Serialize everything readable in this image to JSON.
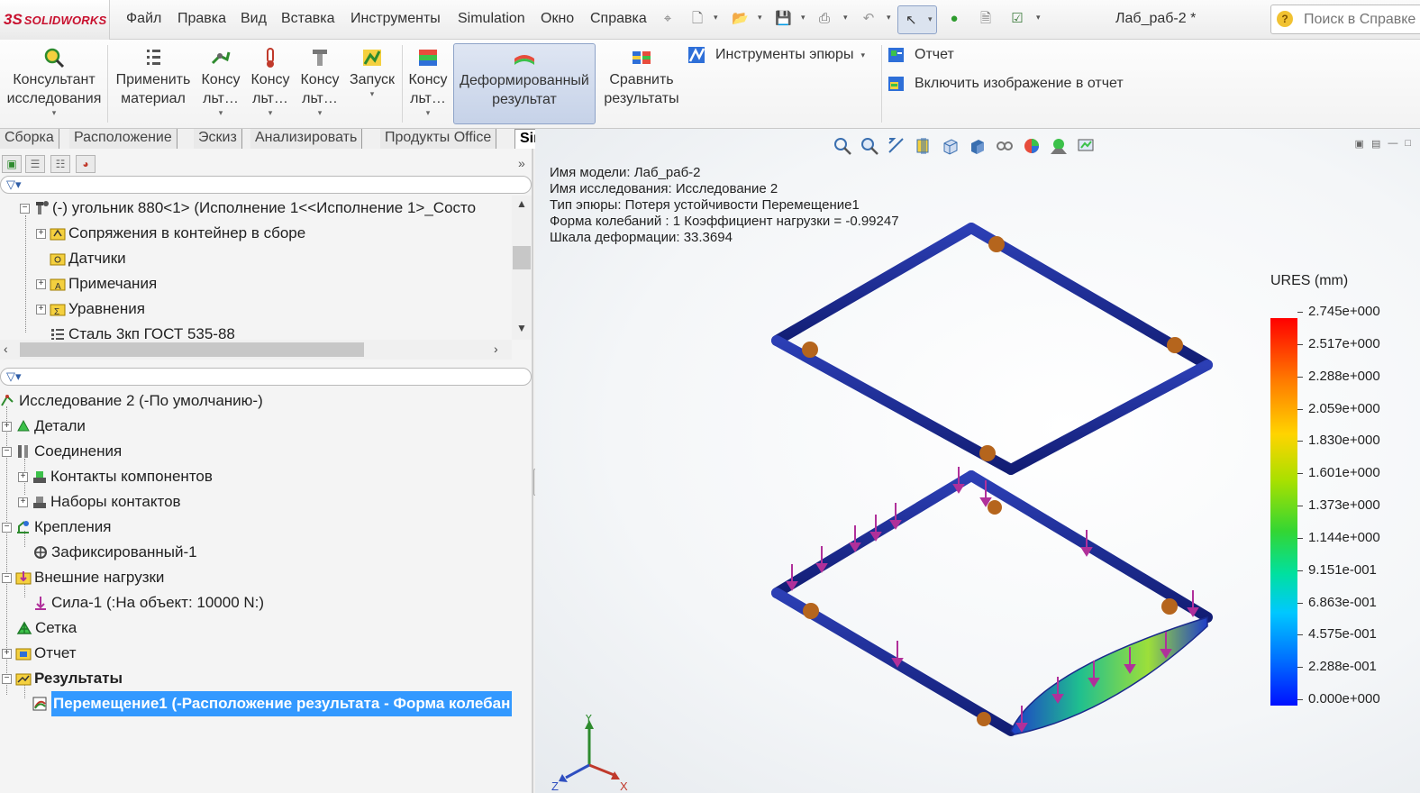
{
  "app": {
    "logo_ds": "3S",
    "logo_name": "SOLIDWORKS"
  },
  "menu": [
    "Файл",
    "Правка",
    "Вид",
    "Вставка",
    "Инструменты",
    "Simulation",
    "Окно",
    "Справка"
  ],
  "document_title": "Лаб_раб-2 *",
  "search": {
    "placeholder": "Поиск в Справке"
  },
  "ribbon": {
    "consultant": "Консультант исследования",
    "apply_material": "Применить материал",
    "konsult1": "Консу льт…",
    "konsult2": "Консу льт…",
    "konsult3": "Консу льт…",
    "run": "Запуск",
    "konsult4": "Консу льт…",
    "deformed": "Деформированный результат",
    "compare": "Сравнить результаты",
    "plot_tools": "Инструменты эпюры",
    "report": "Отчет",
    "include_image": "Включить изображение в отчет"
  },
  "tabs": [
    "Сборка",
    "Расположение",
    "Эскиз",
    "Анализировать",
    "Продукты Office",
    "Simulation"
  ],
  "active_tab": "Simulation",
  "feature_tree": {
    "root": "(-) угольник 880<1> (Исполнение 1<<Исполнение 1>_Состо",
    "items": [
      "Сопряжения в контейнер в сборе",
      "Датчики",
      "Примечания",
      "Уравнения",
      "Сталь 3кп ГОСТ 535-88"
    ]
  },
  "study_tree": {
    "study": "Исследование 2 (-По умолчанию-)",
    "parts": "Детали",
    "connections": "Соединения",
    "component_contacts": "Контакты компонентов",
    "contact_sets": "Наборы контактов",
    "fixtures": "Крепления",
    "fixed": "Зафиксированный-1",
    "external_loads": "Внешние нагрузки",
    "force": "Сила-1 (:На объект: 10000 N:)",
    "mesh": "Сетка",
    "report": "Отчет",
    "results": "Результаты",
    "displacement": "Перемещение1 (-Расположение результата - Форма колебан"
  },
  "plot_info": {
    "model_name": "Имя модели: Лаб_раб-2",
    "study_name": "Имя  исследования: Исследование 2",
    "plot_type": "Тип эпюры: Потеря устойчивости Перемещение1",
    "mode_shape": "Форма колебаний : 1  Коэффициент нагрузки = -0.99247",
    "deformation_scale": "Шкала деформации: 33.3694"
  },
  "legend": {
    "title": "URES (mm)",
    "values": [
      "2.745e+000",
      "2.517e+000",
      "2.288e+000",
      "2.059e+000",
      "1.830e+000",
      "1.601e+000",
      "1.373e+000",
      "1.144e+000",
      "9.151e-001",
      "6.863e-001",
      "4.575e-001",
      "2.288e-001",
      "0.000e+000"
    ]
  },
  "triad": {
    "x": "X",
    "y": "Y",
    "z": "Z"
  },
  "colors": {
    "frame": "#1a2a8c",
    "selection": "#3399ff",
    "load_arrows": "#b0309a",
    "fixtures": "#b5651d"
  }
}
